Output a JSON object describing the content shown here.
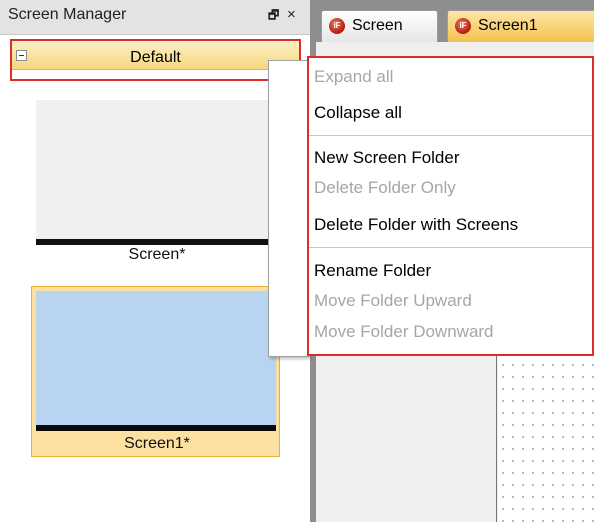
{
  "panel": {
    "title": "Screen Manager",
    "pin_icon": "pin-icon",
    "pin_glyph": "่",
    "close_icon": "close-icon",
    "close_glyph": "×"
  },
  "folder": {
    "label": "Default",
    "toggle_icon": "collapse-box-icon"
  },
  "screens": [
    {
      "caption": "Screen*"
    },
    {
      "caption": "Screen1*"
    }
  ],
  "tabs": [
    {
      "label": "Screen",
      "icon": "screen-app-icon"
    },
    {
      "label": "Screen1",
      "icon": "screen-app-icon"
    }
  ],
  "context_menu": {
    "items": [
      {
        "label": "Expand all",
        "enabled": false
      },
      {
        "label": "Collapse all",
        "enabled": true
      },
      {
        "label": "New Screen Folder",
        "enabled": true
      },
      {
        "label": "Delete Folder Only",
        "enabled": false
      },
      {
        "label": "Delete Folder with Screens",
        "enabled": true
      },
      {
        "label": "Rename Folder",
        "enabled": true
      },
      {
        "label": "Move Folder Upward",
        "enabled": false
      },
      {
        "label": "Move Folder Downward",
        "enabled": false
      }
    ]
  },
  "colors": {
    "highlight_border": "#e02b2b",
    "active_tab": "#f3c24e",
    "selected_thumbnail": "#b9d4f0",
    "disabled_text": "#a6a6a6"
  }
}
